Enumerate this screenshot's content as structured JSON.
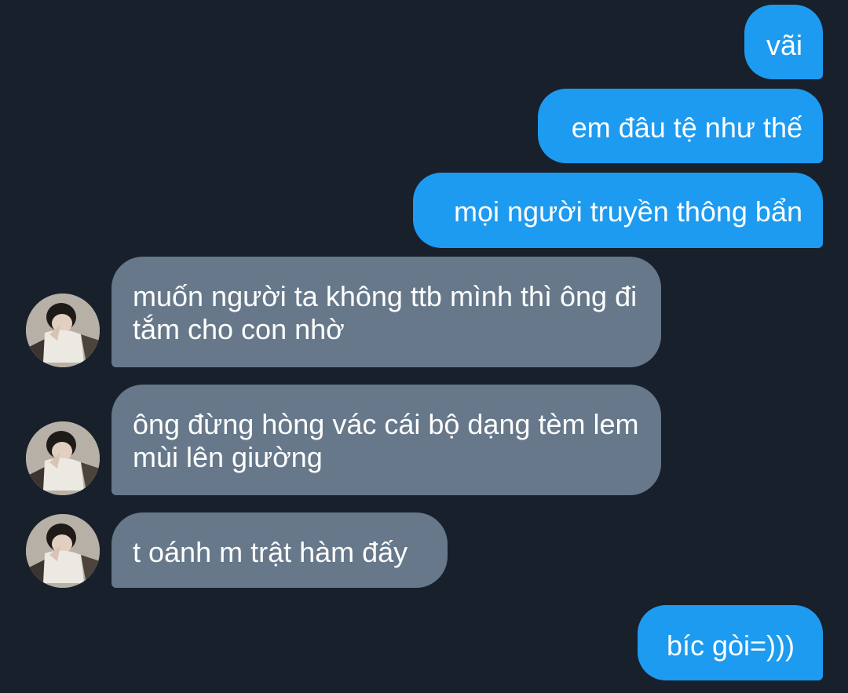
{
  "colors": {
    "background": "#17202b",
    "outgoing_bubble": "#1d9bf0",
    "incoming_bubble": "#66788a",
    "text": "#ffffff"
  },
  "messages": [
    {
      "direction": "outgoing",
      "text": "vãi"
    },
    {
      "direction": "outgoing",
      "text": "em đâu tệ như thế"
    },
    {
      "direction": "outgoing",
      "text": "mọi người truyền thông bẩn"
    },
    {
      "direction": "incoming",
      "text": "muốn người ta không ttb mình thì ông đi tắm cho con nhờ",
      "avatar": "user-avatar"
    },
    {
      "direction": "incoming",
      "text": "ông đừng hòng vác cái bộ dạng tèm lem mùi lên giường",
      "avatar": "user-avatar"
    },
    {
      "direction": "incoming",
      "text": "t oánh m trật hàm đấy",
      "avatar": "user-avatar"
    },
    {
      "direction": "outgoing",
      "text": "bíc gòi=)))"
    }
  ]
}
